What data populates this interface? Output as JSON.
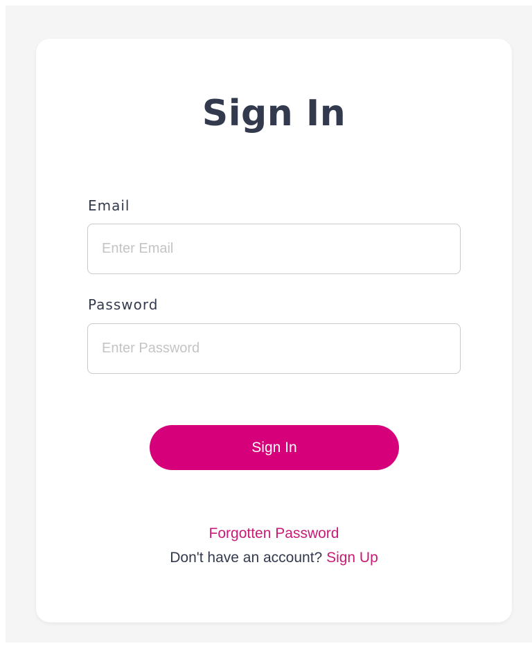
{
  "colors": {
    "background": "#f5f5f5",
    "card": "#ffffff",
    "accent": "#d6007a",
    "link": "#c81a75",
    "text": "#333a4d"
  },
  "form": {
    "title": "Sign In",
    "email_label": "Email",
    "email_placeholder": "Enter Email",
    "email_value": "",
    "password_label": "Password",
    "password_placeholder": "Enter Password",
    "password_value": "",
    "submit_label": "Sign In",
    "forgot_password_label": "Forgotten Password",
    "no_account_text": "Don't have an account? ",
    "signup_label": "Sign Up"
  }
}
